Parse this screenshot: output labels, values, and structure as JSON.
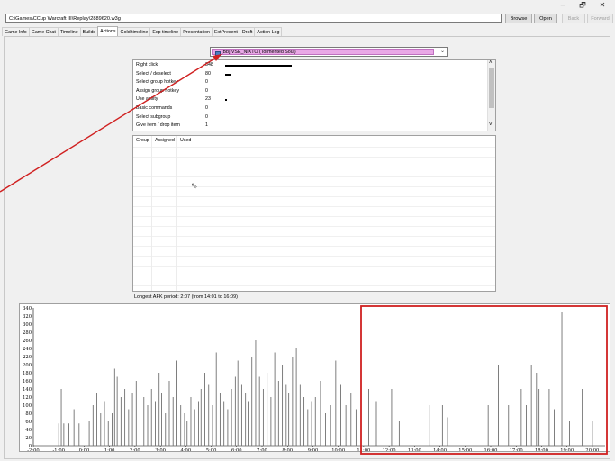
{
  "window": {
    "controls": [
      "–",
      "🗗",
      "✕"
    ]
  },
  "path": {
    "value": "C:\\Games\\CCup Warcraft III\\Replay\\2889620.w3g"
  },
  "buttons": {
    "browse": "Browse",
    "open": "Open",
    "back": "Back",
    "forward": "Forward"
  },
  "tabs": [
    "Game Info",
    "Game Chat",
    "Timeline",
    "Builds",
    "Actions",
    "Gold timeline",
    "Exp timeline",
    "Presentation",
    "ExtPresent",
    "Draft",
    "Action Log"
  ],
  "active_tab": "Actions",
  "player": {
    "selected": "[Bb] VSE_NIXTO (Tormented Soul)"
  },
  "actions": [
    {
      "label": "Right click",
      "value": "848",
      "ratio": 1.0
    },
    {
      "label": "Select / deselect",
      "value": "80",
      "ratio": 0.09
    },
    {
      "label": "Select group hotkey",
      "value": "0",
      "ratio": 0
    },
    {
      "label": "Assign group hotkey",
      "value": "0",
      "ratio": 0
    },
    {
      "label": "Use ability",
      "value": "23",
      "ratio": 0.025
    },
    {
      "label": "Basic commands",
      "value": "0",
      "ratio": 0
    },
    {
      "label": "Select subgroup",
      "value": "0",
      "ratio": 0
    },
    {
      "label": "Give item / drop item",
      "value": "1",
      "ratio": 0
    }
  ],
  "groups": {
    "headers": [
      "Group",
      "Assigned",
      "Used"
    ]
  },
  "afk": {
    "text": "Longest AFK period: 2:07 (from 14:01 to 16:09)"
  },
  "colors": {
    "annotation_red": "#d02020",
    "player_highlight": "#e9a8e6",
    "bar": "#707070"
  },
  "chart_data": {
    "type": "bar",
    "ylim": [
      0,
      340
    ],
    "yticks": [
      0,
      20,
      40,
      60,
      80,
      100,
      120,
      140,
      160,
      180,
      200,
      220,
      240,
      260,
      280,
      300,
      320,
      340
    ],
    "xticks": [
      "-2:00",
      "-1:00",
      "0:00",
      "1:00",
      "2:00",
      "3:00",
      "4:00",
      "5:00",
      "6:00",
      "7:00",
      "8:00",
      "9:00",
      "10:00",
      "11:00",
      "12:00",
      "13:00",
      "14:00",
      "15:00",
      "16:00",
      "17:00",
      "18:00",
      "19:00",
      "20:00"
    ],
    "xlim": [
      -2.0,
      20.5
    ],
    "points": [
      [
        -1.0,
        55
      ],
      [
        -0.9,
        140
      ],
      [
        -0.8,
        55
      ],
      [
        -0.6,
        55
      ],
      [
        -0.4,
        90
      ],
      [
        -0.2,
        55
      ],
      [
        0.2,
        60
      ],
      [
        0.35,
        100
      ],
      [
        0.5,
        130
      ],
      [
        0.65,
        80
      ],
      [
        0.8,
        110
      ],
      [
        0.95,
        60
      ],
      [
        1.1,
        80
      ],
      [
        1.2,
        190
      ],
      [
        1.3,
        170
      ],
      [
        1.45,
        120
      ],
      [
        1.6,
        140
      ],
      [
        1.75,
        90
      ],
      [
        1.9,
        130
      ],
      [
        2.05,
        160
      ],
      [
        2.2,
        200
      ],
      [
        2.35,
        120
      ],
      [
        2.5,
        100
      ],
      [
        2.65,
        140
      ],
      [
        2.8,
        110
      ],
      [
        2.95,
        180
      ],
      [
        3.05,
        130
      ],
      [
        3.2,
        80
      ],
      [
        3.35,
        160
      ],
      [
        3.5,
        120
      ],
      [
        3.65,
        210
      ],
      [
        3.8,
        100
      ],
      [
        3.95,
        80
      ],
      [
        4.05,
        60
      ],
      [
        4.2,
        120
      ],
      [
        4.35,
        90
      ],
      [
        4.5,
        110
      ],
      [
        4.6,
        140
      ],
      [
        4.75,
        180
      ],
      [
        4.9,
        150
      ],
      [
        5.05,
        100
      ],
      [
        5.2,
        230
      ],
      [
        5.35,
        130
      ],
      [
        5.5,
        110
      ],
      [
        5.65,
        90
      ],
      [
        5.8,
        140
      ],
      [
        5.95,
        170
      ],
      [
        6.05,
        210
      ],
      [
        6.2,
        150
      ],
      [
        6.35,
        130
      ],
      [
        6.45,
        110
      ],
      [
        6.6,
        220
      ],
      [
        6.75,
        260
      ],
      [
        6.9,
        170
      ],
      [
        7.05,
        140
      ],
      [
        7.2,
        180
      ],
      [
        7.35,
        120
      ],
      [
        7.5,
        230
      ],
      [
        7.65,
        160
      ],
      [
        7.8,
        200
      ],
      [
        7.95,
        150
      ],
      [
        8.05,
        130
      ],
      [
        8.2,
        220
      ],
      [
        8.35,
        240
      ],
      [
        8.5,
        150
      ],
      [
        8.65,
        120
      ],
      [
        8.8,
        90
      ],
      [
        8.95,
        110
      ],
      [
        9.1,
        120
      ],
      [
        9.3,
        160
      ],
      [
        9.5,
        80
      ],
      [
        9.7,
        100
      ],
      [
        9.9,
        210
      ],
      [
        10.1,
        150
      ],
      [
        10.3,
        100
      ],
      [
        10.5,
        130
      ],
      [
        10.7,
        90
      ],
      [
        10.9,
        60
      ],
      [
        11.2,
        140
      ],
      [
        11.5,
        110
      ],
      [
        12.1,
        140
      ],
      [
        12.4,
        60
      ],
      [
        13.6,
        100
      ],
      [
        14.1,
        100
      ],
      [
        14.3,
        70
      ],
      [
        15.9,
        100
      ],
      [
        16.3,
        200
      ],
      [
        16.7,
        100
      ],
      [
        17.2,
        140
      ],
      [
        17.4,
        100
      ],
      [
        17.6,
        200
      ],
      [
        17.8,
        180
      ],
      [
        17.9,
        140
      ],
      [
        18.3,
        140
      ],
      [
        18.5,
        90
      ],
      [
        18.8,
        330
      ],
      [
        19.1,
        60
      ],
      [
        19.6,
        140
      ],
      [
        20.0,
        60
      ]
    ]
  }
}
